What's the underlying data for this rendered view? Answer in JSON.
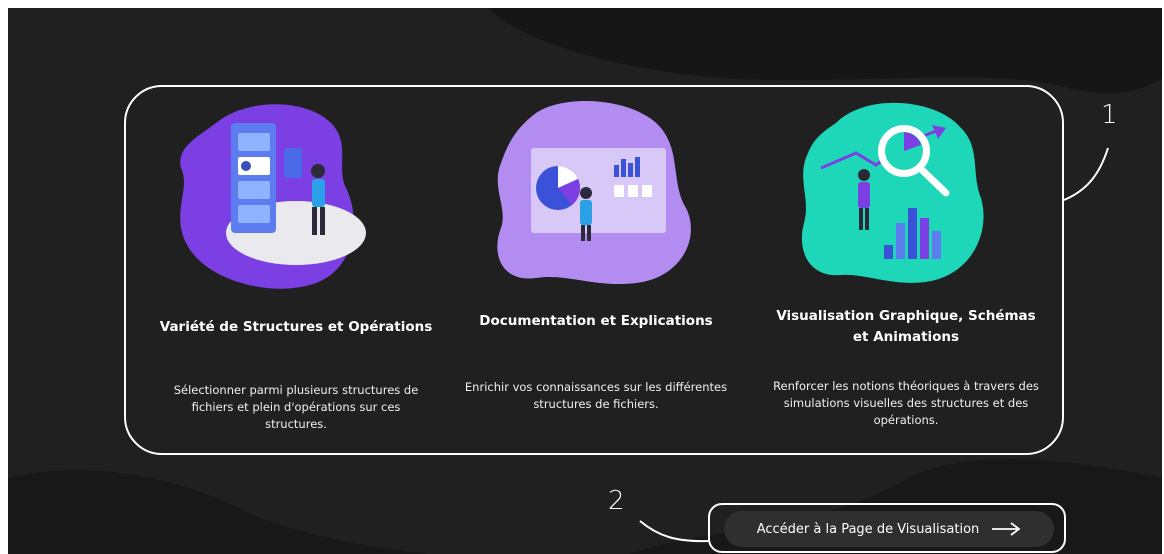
{
  "features": [
    {
      "title_lines": [
        "Variété de Structures et Opérations"
      ],
      "description_lines": [
        "Sélectionner parmi plusieurs structures de",
        "fichiers et plein d'opérations sur ces",
        "structures."
      ],
      "illustration": "structures-selection-illustration",
      "blob_color": "#7b3fe4"
    },
    {
      "title_lines": [
        "Documentation et Explications"
      ],
      "description_lines": [
        "Enrichir vos connaissances sur les différentes",
        "structures de fichiers."
      ],
      "illustration": "documentation-presentation-illustration",
      "blob_color": "#b38cf2"
    },
    {
      "title_lines": [
        "Visualisation Graphique, Schémas",
        "et Animations"
      ],
      "description_lines": [
        "Renforcer les notions théoriques à travers des",
        "simulations visuelles des structures et des",
        "opérations."
      ],
      "illustration": "visualisation-magnifier-illustration",
      "blob_color": "#1ed7b8"
    }
  ],
  "annotations": {
    "one": "1",
    "two": "2"
  },
  "cta": {
    "label": "Accéder à la Page de Visualisation",
    "icon": "arrow-right-icon"
  },
  "colors": {
    "background": "#202020",
    "accent_purple": "#7b3fe4",
    "accent_teal": "#1ed7b8",
    "button": "#2f2f2f"
  }
}
